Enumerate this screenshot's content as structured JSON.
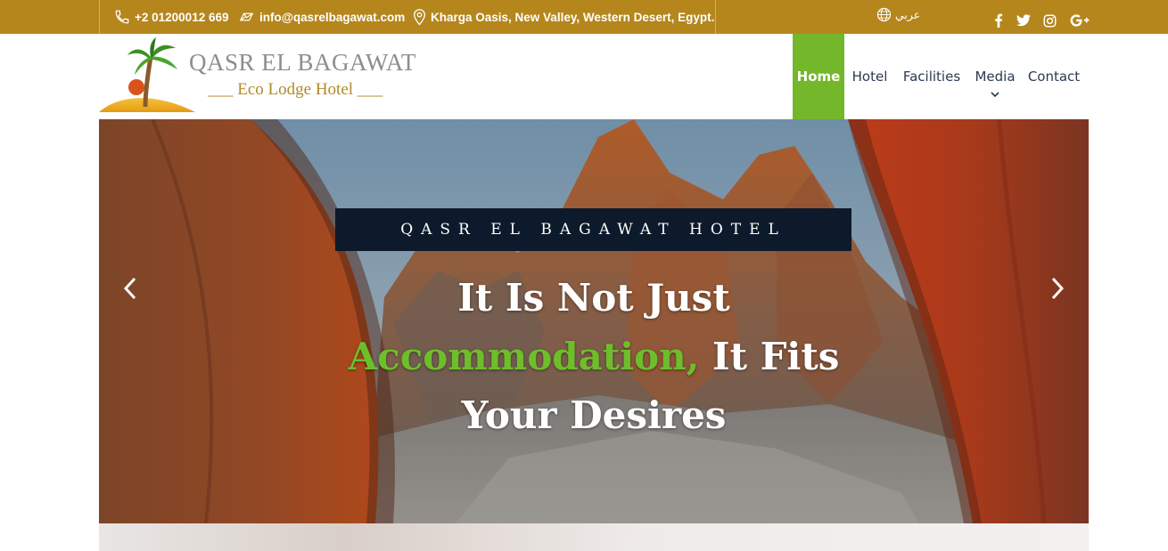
{
  "topbar": {
    "phone": "+2 01200012 669",
    "email": "info@qasrelbagawat.com",
    "address": "Kharga Oasis, New Valley, Western Desert, Egypt.",
    "language": "عربي",
    "social": [
      "facebook-icon",
      "twitter-icon",
      "instagram-icon",
      "google-plus-icon"
    ],
    "background_color": "#b5861c"
  },
  "header": {
    "logo_title": "QASR EL BAGAWAT",
    "logo_subtitle": "Eco Lodge Hotel",
    "nav": [
      {
        "label": "Home",
        "active": true
      },
      {
        "label": "Hotel",
        "active": false
      },
      {
        "label": "Facilities",
        "active": false
      },
      {
        "label": "Media",
        "active": false,
        "dropdown": true
      },
      {
        "label": "Contact",
        "active": false
      }
    ],
    "active_color": "#75b72a"
  },
  "hero": {
    "tagline": "QASR EL BAGAWAT HOTEL",
    "heading_line1": "It Is Not Just",
    "heading_accent": "Accommodation,",
    "heading_line2_rest": " It Fits",
    "heading_line3": "Your Desires",
    "accent_color": "#6dbf2a",
    "prev_icon": "chevron-left-icon",
    "next_icon": "chevron-right-icon"
  }
}
